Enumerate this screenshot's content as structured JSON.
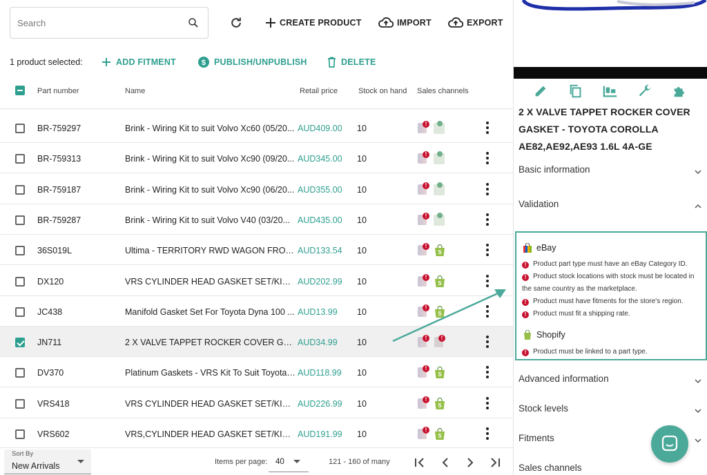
{
  "search": {
    "placeholder": "Search"
  },
  "toolbar": {
    "create": "CREATE PRODUCT",
    "import": "IMPORT",
    "export": "EXPORT"
  },
  "selection": {
    "text": "1 product selected:",
    "add_fitment": "ADD FITMENT",
    "publish": "PUBLISH/UNPUBLISH",
    "delete": "DELETE"
  },
  "columns": {
    "part_number": "Part number",
    "name": "Name",
    "retail_price": "Retail price",
    "stock": "Stock on hand",
    "channels": "Sales channels"
  },
  "rows": [
    {
      "part": "BR-759297",
      "name": "Brink - Wiring Kit to suit Volvo Xc60 (05/20...",
      "price": "AUD409.00",
      "stock": "10",
      "shopify": "pending",
      "checked": false
    },
    {
      "part": "BR-759313",
      "name": "Brink - Wiring Kit to suit Volvo Xc90 (09/20...",
      "price": "AUD345.00",
      "stock": "10",
      "shopify": "pending",
      "checked": false
    },
    {
      "part": "BR-759187",
      "name": "Brink - Wiring Kit to suit Volvo Xc90 (06/20...",
      "price": "AUD355.00",
      "stock": "10",
      "shopify": "pending",
      "checked": false
    },
    {
      "part": "BR-759287",
      "name": "Brink - Wiring Kit to suit Volvo V40 (03/20...",
      "price": "AUD435.00",
      "stock": "10",
      "shopify": "pending",
      "checked": false
    },
    {
      "part": "36S019L",
      "name": "Ultima - TERRITORY RWD WAGON FRONT ...",
      "price": "AUD133.54",
      "stock": "10",
      "shopify": "active",
      "checked": false
    },
    {
      "part": "DX120",
      "name": "VRS CYLINDER HEAD GASKET SET/KIT T...",
      "price": "AUD202.99",
      "stock": "10",
      "shopify": "active",
      "checked": false
    },
    {
      "part": "JC438",
      "name": "Manifold Gasket Set For Toyota Dyna 100 ...",
      "price": "AUD13.99",
      "stock": "10",
      "shopify": "active",
      "checked": false
    },
    {
      "part": "JN711",
      "name": "2 X VALVE TAPPET ROCKER COVER GASK...",
      "price": "AUD34.99",
      "stock": "10",
      "shopify": "error",
      "checked": true
    },
    {
      "part": "DV370",
      "name": "Platinum Gaskets - VRS Kit To Suit Toyota ...",
      "price": "AUD118.99",
      "stock": "10",
      "shopify": "active",
      "checked": false
    },
    {
      "part": "VRS418",
      "name": "VRS CYLINDER HEAD GASKET SET/KIT - ...",
      "price": "AUD226.99",
      "stock": "10",
      "shopify": "active",
      "checked": false
    },
    {
      "part": "VRS602",
      "name": "VRS,CYLINDER HEAD GASKET SET/KIT - H...",
      "price": "AUD191.99",
      "stock": "10",
      "shopify": "active",
      "checked": false
    }
  ],
  "footer": {
    "sort_label": "Sort By",
    "sort_value": "New Arrivals",
    "ipp_label": "Items per page:",
    "ipp_value": "40",
    "range": "121 - 160 of many"
  },
  "detail": {
    "title": "2 X VALVE TAPPET ROCKER COVER GASKET - TOYOTA COROLLA AE82,AE92,AE93 1.6L 4A-GE",
    "sections": {
      "basic": "Basic information",
      "validation": "Validation",
      "advanced": "Advanced information",
      "stock": "Stock levels",
      "fitments": "Fitments",
      "sales": "Sales channels"
    },
    "validation": {
      "ebay_name": "eBay",
      "ebay_msgs": [
        "Product part type must have an eBay Category ID.",
        "Product stock locations with stock must be located in the same country as the marketplace.",
        "Product must have fitments for the store's region.",
        "Product must fit a shipping rate."
      ],
      "shopify_name": "Shopify",
      "shopify_msgs": [
        "Product must be linked to a part type."
      ]
    }
  },
  "colors": {
    "accent": "#2e9f8f",
    "error": "#c8102e",
    "box_border": "#4ba99a"
  }
}
